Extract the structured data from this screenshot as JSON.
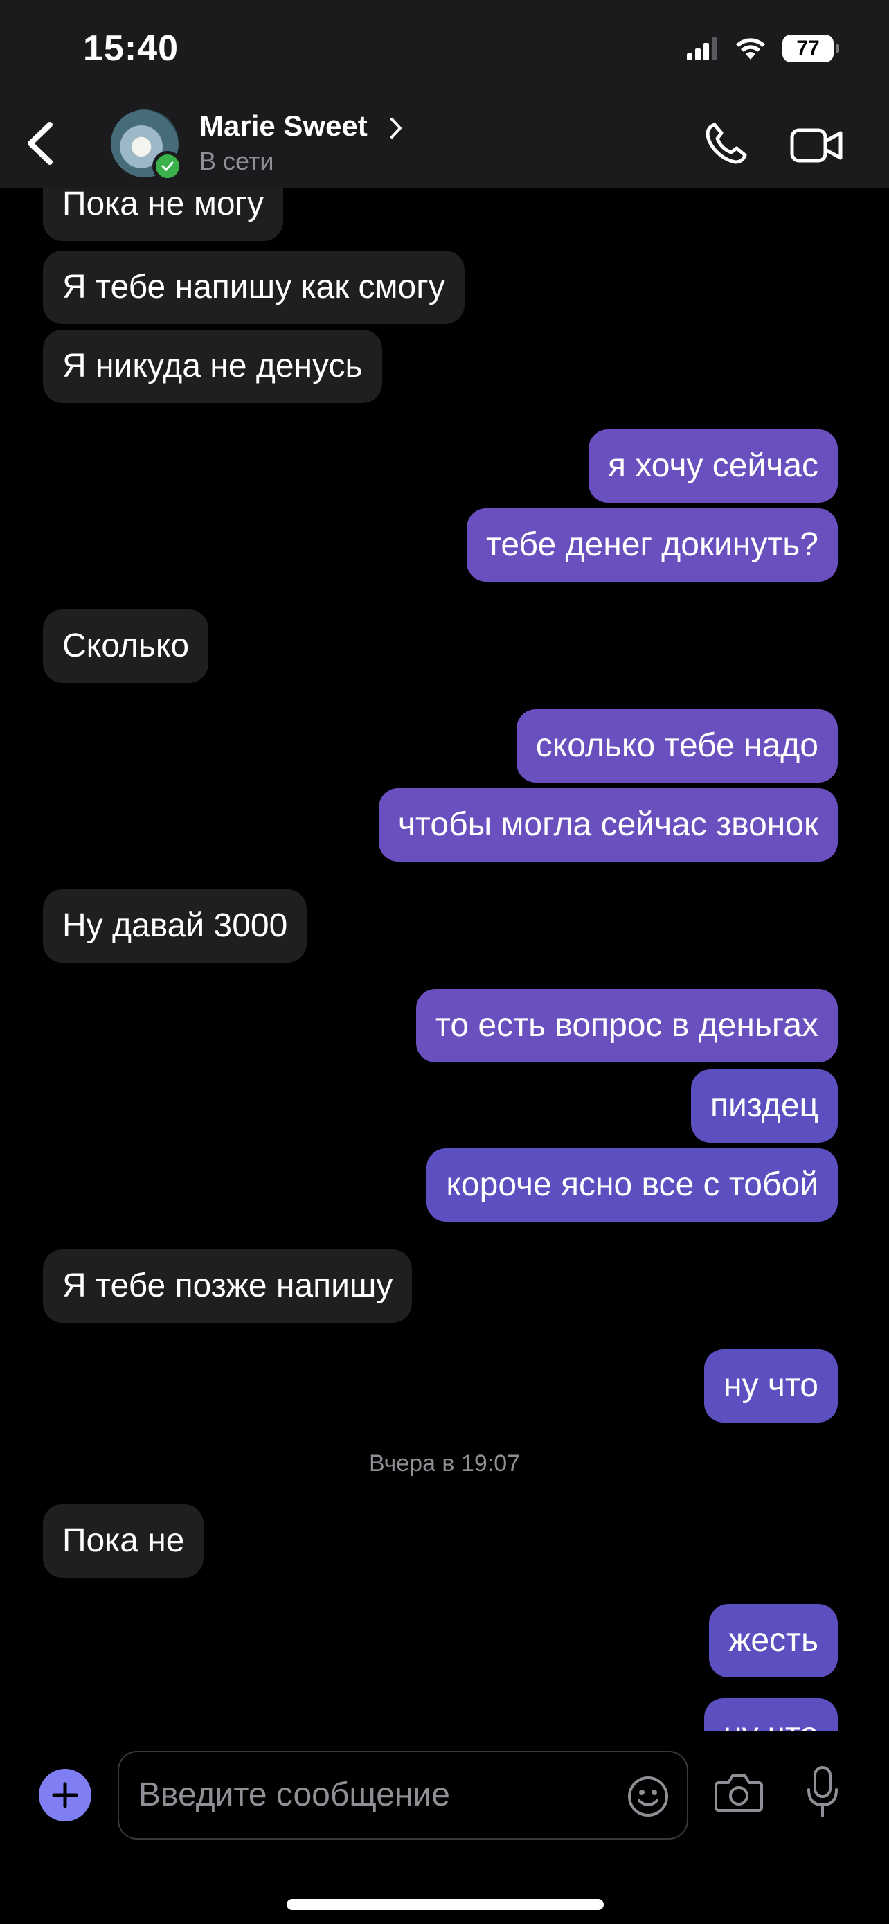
{
  "status_bar": {
    "time": "15:40",
    "battery": "77"
  },
  "header": {
    "contact_name": "Marie Sweet",
    "contact_status": "В сети"
  },
  "messages": [
    {
      "text": "Пока не могу",
      "dir": "in"
    },
    {
      "text": "Я тебе напишу как смогу",
      "dir": "in"
    },
    {
      "text": "Я никуда не денусь",
      "dir": "in"
    },
    {
      "text": "я хочу сейчас",
      "dir": "out"
    },
    {
      "text": "тебе денег докинуть?",
      "dir": "out"
    },
    {
      "text": "Сколько",
      "dir": "in"
    },
    {
      "text": "сколько тебе надо",
      "dir": "out"
    },
    {
      "text": "чтобы могла сейчас звонок",
      "dir": "out"
    },
    {
      "text": "Ну давай 3000",
      "dir": "in"
    },
    {
      "text": "то есть вопрос в деньгах",
      "dir": "out"
    },
    {
      "text": "пиздец",
      "dir": "out"
    },
    {
      "text": "короче ясно все с тобой",
      "dir": "out"
    },
    {
      "text": "Я тебе позже напишу",
      "dir": "in"
    },
    {
      "text": "ну что",
      "dir": "out"
    },
    {
      "text": "Пока не",
      "dir": "in"
    },
    {
      "text": "жесть",
      "dir": "out"
    },
    {
      "text": "ну что",
      "dir": "out"
    }
  ],
  "date_separator": "Вчера в 19:07",
  "composer": {
    "placeholder": "Введите сообщение"
  },
  "colors": {
    "outgoing": "#6a4fbf",
    "incoming": "#1f1f21",
    "accent": "#7f7ef2",
    "online": "#3ab14a"
  },
  "icons": [
    "back-chevron-icon",
    "phone-icon",
    "video-icon",
    "plus-icon",
    "emoji-icon",
    "camera-icon",
    "microphone-icon",
    "signal-icon",
    "wifi-icon",
    "battery-icon"
  ]
}
